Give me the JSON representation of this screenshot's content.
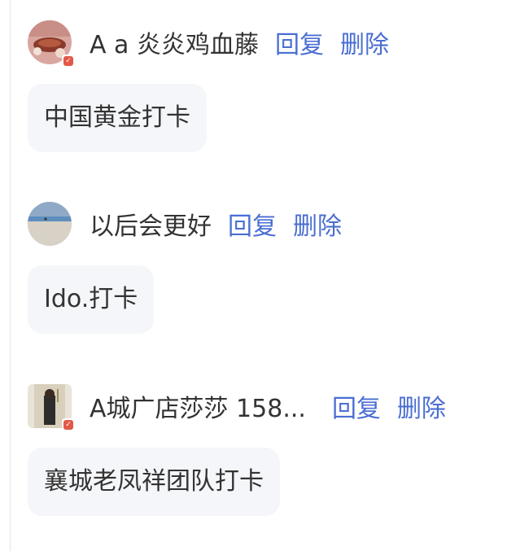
{
  "comments": [
    {
      "author": "A a 炎炎鸡血藤",
      "content": "中国黄金打卡",
      "reply_label": "回复",
      "delete_label": "删除"
    },
    {
      "author": "以后会更好",
      "content": "Ido.打卡",
      "reply_label": "回复",
      "delete_label": "删除"
    },
    {
      "author": "A城广店莎莎 158...",
      "content": "襄城老凤祥团队打卡",
      "reply_label": "回复",
      "delete_label": "删除"
    }
  ],
  "colors": {
    "action": "#4a6ed2",
    "bubble_bg": "#f5f6f9",
    "text": "#333333"
  }
}
